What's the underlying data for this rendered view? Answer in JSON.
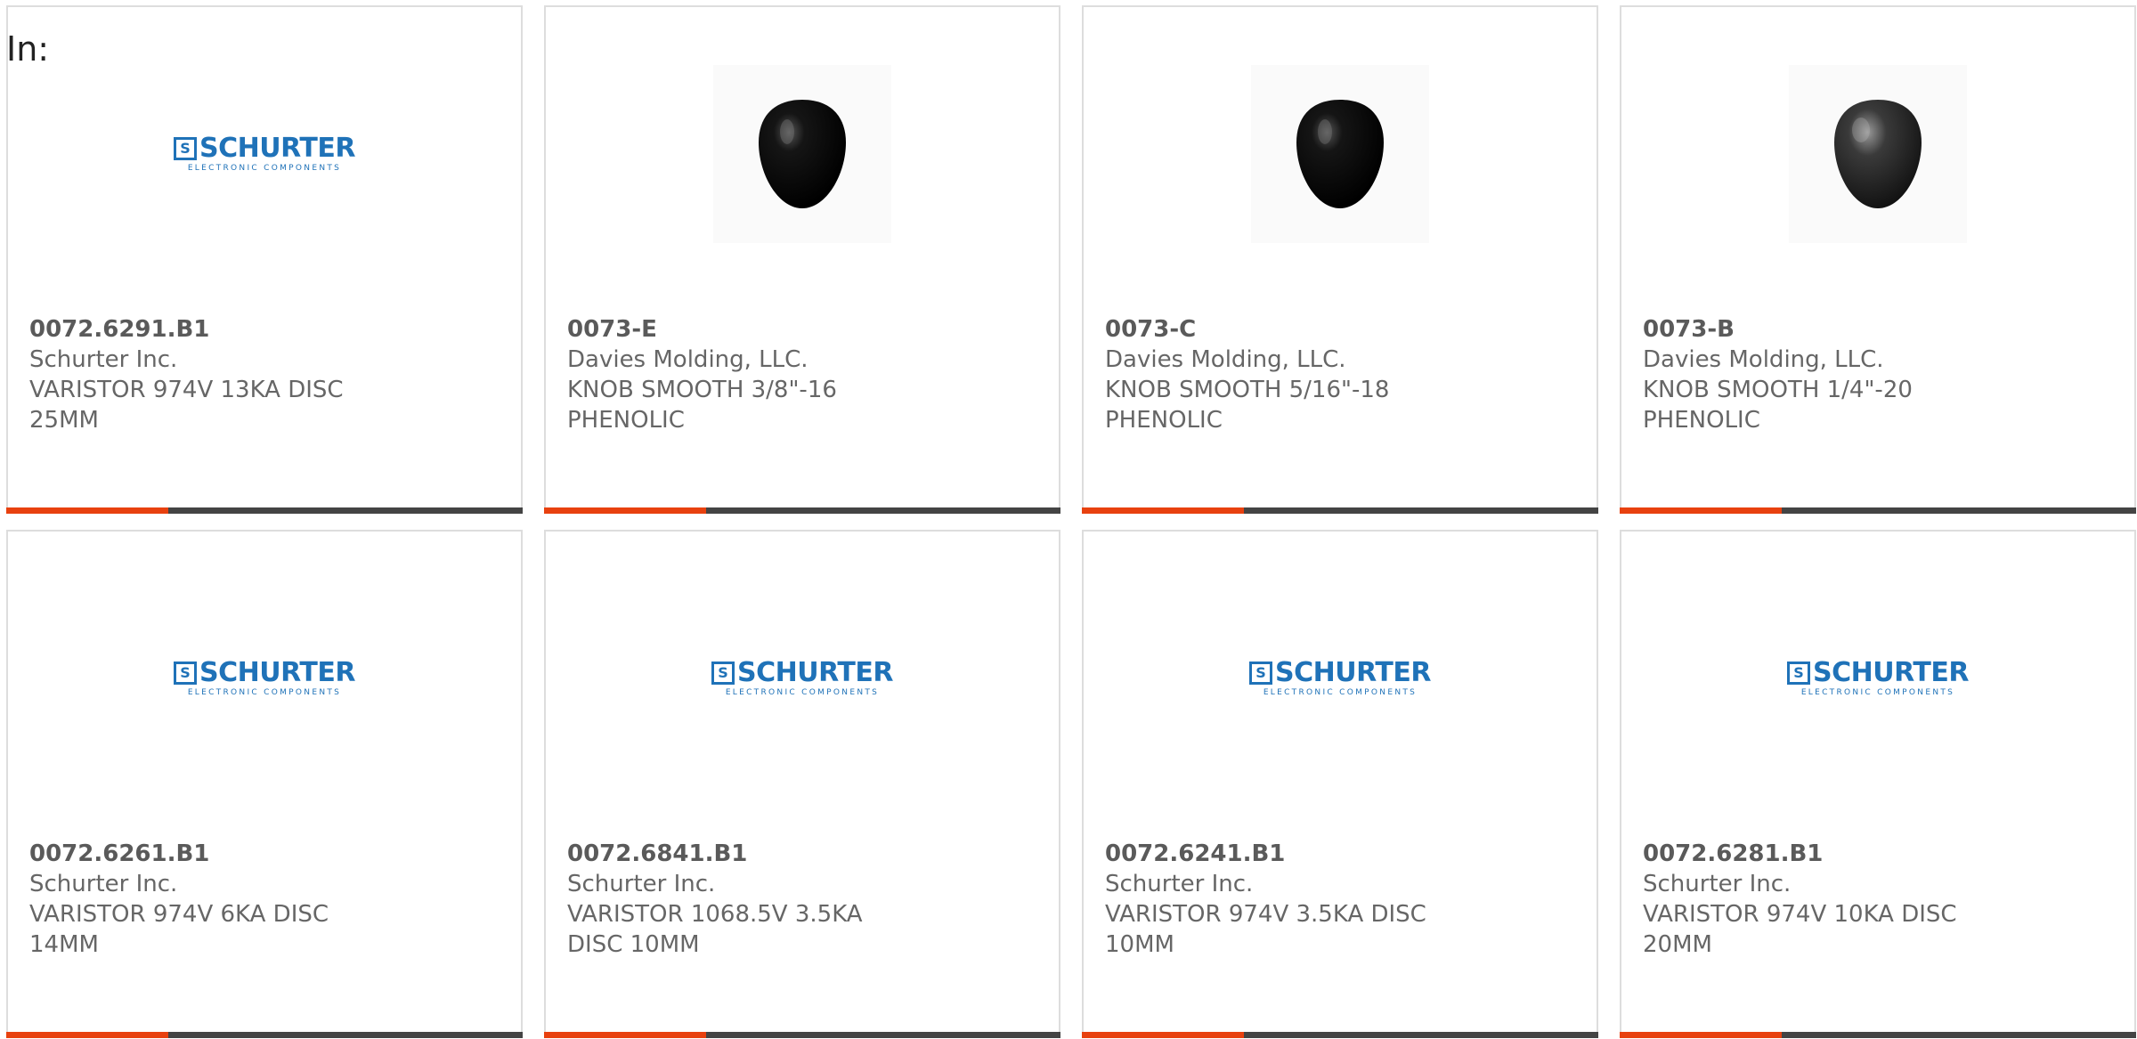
{
  "in_label": "In:",
  "colors": {
    "accent": "#e8410f",
    "bar_dark": "#444444",
    "schurter_blue": "#1f72b8"
  },
  "logo": {
    "mark": "S",
    "name": "SCHURTER",
    "subtitle": "ELECTRONIC COMPONENTS"
  },
  "products": [
    {
      "image": "schurter-logo",
      "part_number": "0072.6291.B1",
      "manufacturer": "Schurter Inc.",
      "description": "VARISTOR 974V 13KA DISC 25MM"
    },
    {
      "image": "knob",
      "part_number": "0073-E",
      "manufacturer": "Davies Molding, LLC.",
      "description": "KNOB SMOOTH 3/8\"-16 PHENOLIC"
    },
    {
      "image": "knob",
      "part_number": "0073-C",
      "manufacturer": "Davies Molding, LLC.",
      "description": "KNOB SMOOTH 5/16\"-18 PHENOLIC"
    },
    {
      "image": "knob-matte",
      "part_number": "0073-B",
      "manufacturer": "Davies Molding, LLC.",
      "description": "KNOB SMOOTH 1/4\"-20 PHENOLIC"
    },
    {
      "image": "schurter-logo",
      "part_number": "0072.6261.B1",
      "manufacturer": "Schurter Inc.",
      "description": "VARISTOR 974V 6KA DISC 14MM"
    },
    {
      "image": "schurter-logo",
      "part_number": "0072.6841.B1",
      "manufacturer": "Schurter Inc.",
      "description": "VARISTOR 1068.5V 3.5KA DISC 10MM"
    },
    {
      "image": "schurter-logo",
      "part_number": "0072.6241.B1",
      "manufacturer": "Schurter Inc.",
      "description": "VARISTOR 974V 3.5KA DISC 10MM"
    },
    {
      "image": "schurter-logo",
      "part_number": "0072.6281.B1",
      "manufacturer": "Schurter Inc.",
      "description": "VARISTOR 974V 10KA DISC 20MM"
    }
  ]
}
